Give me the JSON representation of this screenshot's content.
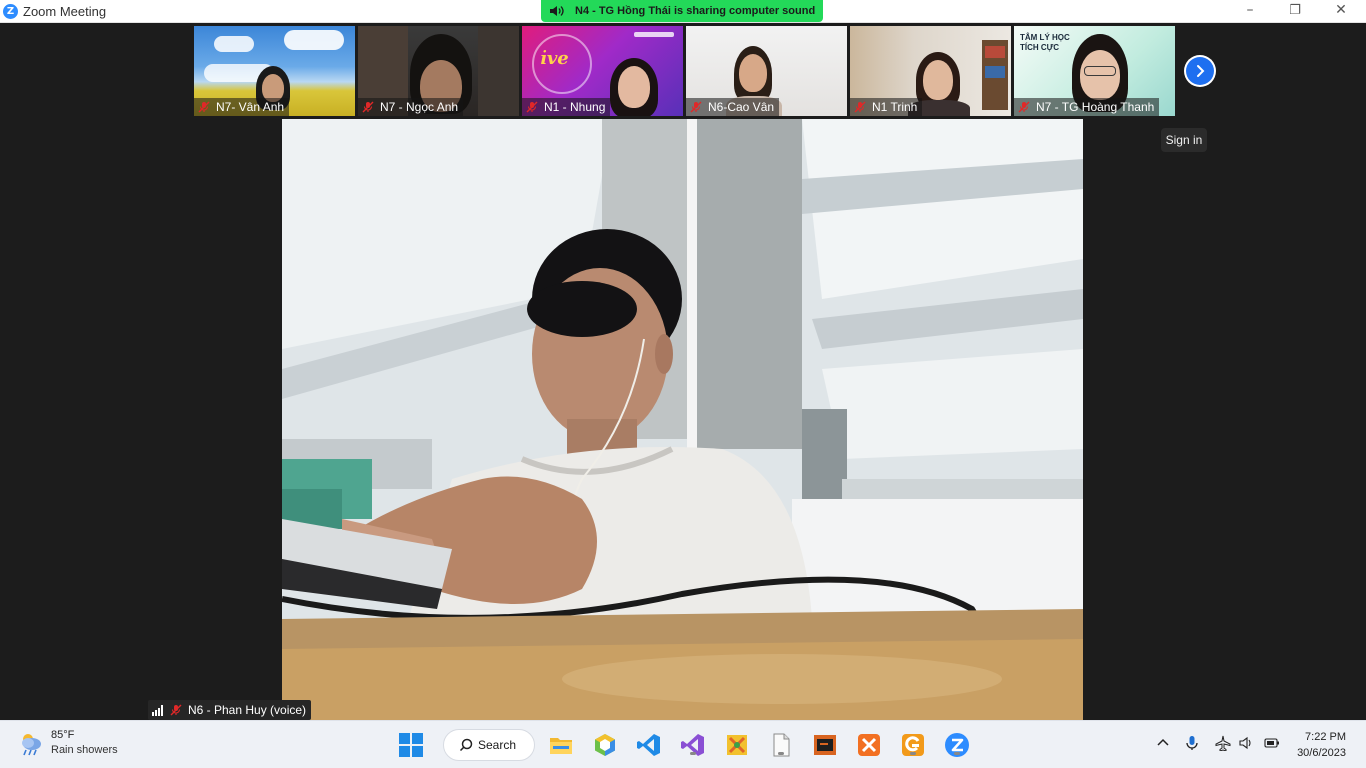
{
  "window": {
    "title": "Zoom Meeting",
    "minimize": "–",
    "restore": "❐",
    "close": "✕"
  },
  "banner": {
    "text": "N4 - TG Hồng Thái is sharing computer sound"
  },
  "participants": [
    {
      "name": "N7- Vân Anh",
      "muted": true
    },
    {
      "name": "N7 - Ngọc Anh",
      "muted": true
    },
    {
      "name": "N1 - Nhung",
      "muted": true
    },
    {
      "name": "N6-Cao Vân",
      "muted": true
    },
    {
      "name": "N1 Trinh",
      "muted": true
    },
    {
      "name": "N7 - TG Hoàng Thanh",
      "muted": true
    }
  ],
  "thumb_overlay": {
    "line1": "TÂM LÝ HỌC",
    "line2": "TÍCH CỰC"
  },
  "sign_in": "Sign in",
  "active_speaker": {
    "name": "N6 - Phan Huy (voice)",
    "muted": true
  },
  "taskbar": {
    "weather_temp": "85°F",
    "weather_desc": "Rain showers",
    "search_label": "Search",
    "time": "7:22 PM",
    "date": "30/6/2023"
  },
  "colors": {
    "zoom_blue": "#2d8cff",
    "share_green": "#23d959",
    "mute_red": "#e02828"
  }
}
